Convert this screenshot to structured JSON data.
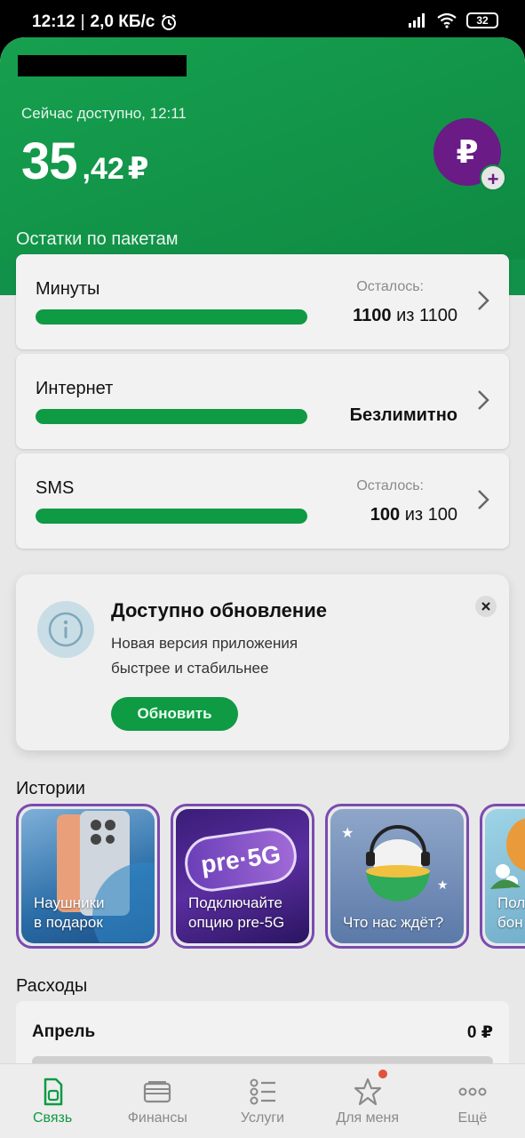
{
  "status_bar": {
    "time": "12:12",
    "separator": "|",
    "speed": "2,0 КБ/с",
    "battery": "32"
  },
  "header": {
    "available_label": "Сейчас доступно, 12:11",
    "balance_int": "35",
    "balance_dec": ",42",
    "currency": "₽",
    "topup_symbol": "₽",
    "topup_plus": "+"
  },
  "packages": {
    "title": "Остатки по пакетам",
    "items": [
      {
        "name": "Минуты",
        "left_label": "Осталось:",
        "value_bold": "1100",
        "value_rest": " из 1100",
        "fill": 1.0
      },
      {
        "name": "Интернет",
        "left_label": "",
        "value_bold": "Безлимитно",
        "value_rest": "",
        "fill": 1.0
      },
      {
        "name": "SMS",
        "left_label": "Осталось:",
        "value_bold": "100",
        "value_rest": " из 100",
        "fill": 1.0
      }
    ]
  },
  "update": {
    "title": "Доступно обновление",
    "text_line1": "Новая версия приложения",
    "text_line2": "быстрее и стабильнее",
    "button": "Обновить"
  },
  "stories": {
    "title": "Истории",
    "items": [
      {
        "line1": "Наушники",
        "line2": "в подарок"
      },
      {
        "line1": "Подключайте",
        "line2": "опцию pre-5G",
        "art": "pre·5G"
      },
      {
        "line1": "Что нас ждёт?",
        "line2": ""
      },
      {
        "line1": "Пол",
        "line2": "бон"
      }
    ]
  },
  "expenses": {
    "title": "Расходы",
    "month": "Апрель",
    "amount": "0 ₽"
  },
  "nav": {
    "items": [
      {
        "label": "Связь",
        "icon": "sim-icon"
      },
      {
        "label": "Финансы",
        "icon": "wallet-icon"
      },
      {
        "label": "Услуги",
        "icon": "list-icon"
      },
      {
        "label": "Для меня",
        "icon": "star-icon"
      },
      {
        "label": "Ещё",
        "icon": "more-icon"
      }
    ]
  },
  "colors": {
    "brand_green": "#0f9a44",
    "topup_purple": "#6a1b86",
    "story_border": "#7a4bb0"
  }
}
